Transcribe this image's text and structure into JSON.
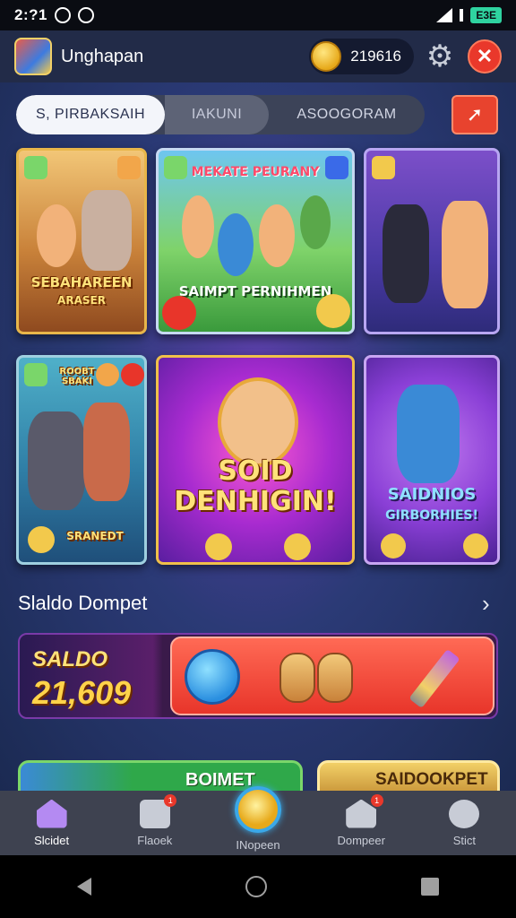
{
  "status_bar": {
    "time": "2:?1",
    "battery": "E3E",
    "icons": [
      "signal-icon",
      "wifi-icon",
      "battery-icon"
    ]
  },
  "header": {
    "app_title": "Unghapan",
    "coin_balance": "219616",
    "icons": [
      "app-logo",
      "coin-icon",
      "gear-icon",
      "alert-icon"
    ]
  },
  "tabs": [
    {
      "label": "S, PIRBAKSAIH",
      "active": true
    },
    {
      "label": "IAKUNI",
      "active": false
    },
    {
      "label": "ASOOGORAM",
      "active": false
    }
  ],
  "games": [
    {
      "title": "SEBAHAREEN",
      "subtitle": "ARASER"
    },
    {
      "title": "MEKATE PEURANY",
      "subtitle": "SAIMPT PERNIHMEN"
    },
    {
      "title": "",
      "subtitle": ""
    },
    {
      "title": "ROOBT SBAKI",
      "subtitle": "SRANEDT"
    },
    {
      "title": "SOID DENHIGIN!",
      "subtitle": ""
    },
    {
      "title": "SAIDNIOS",
      "subtitle": "GIRBORHIES!"
    }
  ],
  "wallet": {
    "section_title": "Slaldo Dompet",
    "saldo_label": "SALDO",
    "saldo_value": "21,609"
  },
  "promo": {
    "left_label": "BOIMET",
    "right_label": "SAIDOOKPET"
  },
  "bottom_nav": [
    {
      "label": "Slcidet",
      "icon": "home-icon",
      "active": true,
      "badge": ""
    },
    {
      "label": "Flaoek",
      "icon": "gamepad-icon",
      "active": false,
      "badge": "1"
    },
    {
      "label": "INopeen",
      "icon": "coin-icon",
      "active": false,
      "badge": ""
    },
    {
      "label": "Dompeer",
      "icon": "wallet-icon",
      "active": false,
      "badge": "1"
    },
    {
      "label": "Stict",
      "icon": "profile-icon",
      "active": false,
      "badge": ""
    }
  ],
  "colors": {
    "accent_red": "#e9382b",
    "gold": "#ffd34a",
    "bg": "#1d2744"
  }
}
